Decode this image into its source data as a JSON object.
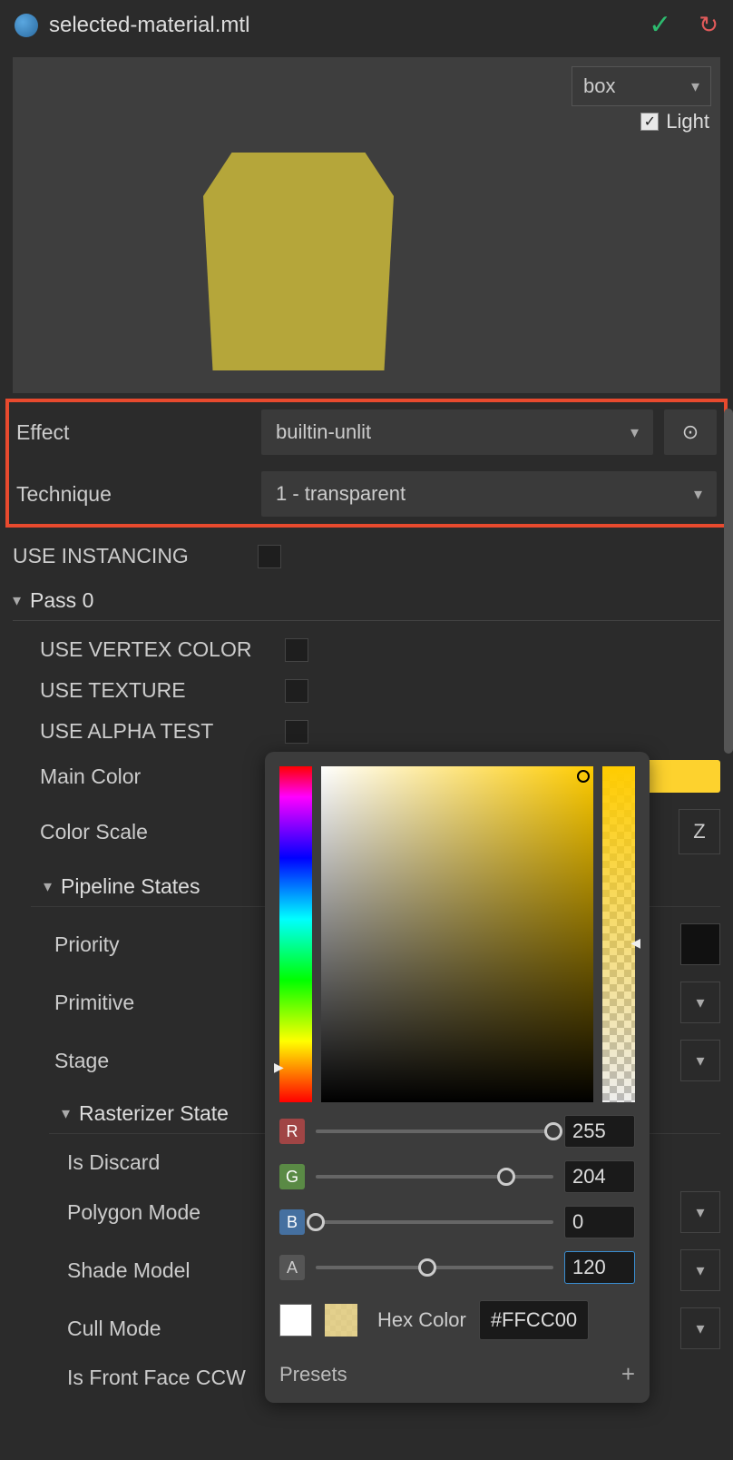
{
  "titlebar": {
    "filename": "selected-material.mtl"
  },
  "preview": {
    "shape_dropdown": "box",
    "light_label": "Light",
    "light_checked": true
  },
  "fields": {
    "effect": {
      "label": "Effect",
      "value": "builtin-unlit"
    },
    "technique": {
      "label": "Technique",
      "value": "1 - transparent"
    },
    "use_instancing": {
      "label": "USE INSTANCING"
    },
    "pass0": {
      "label": "Pass 0"
    },
    "use_vertex_color": {
      "label": "USE VERTEX COLOR"
    },
    "use_texture": {
      "label": "USE TEXTURE"
    },
    "use_alpha_test": {
      "label": "USE ALPHA TEST"
    },
    "main_color": {
      "label": "Main Color"
    },
    "color_scale": {
      "label": "Color Scale",
      "z": "Z"
    },
    "pipeline_states": {
      "label": "Pipeline States"
    },
    "priority": {
      "label": "Priority"
    },
    "primitive": {
      "label": "Primitive"
    },
    "stage": {
      "label": "Stage"
    },
    "rasterizer_state": {
      "label": "Rasterizer State"
    },
    "is_discard": {
      "label": "Is Discard"
    },
    "polygon_mode": {
      "label": "Polygon Mode"
    },
    "shade_model": {
      "label": "Shade Model"
    },
    "cull_mode": {
      "label": "Cull Mode"
    },
    "is_front_face_ccw": {
      "label": "Is Front Face CCW"
    }
  },
  "color_picker": {
    "r": {
      "label": "R",
      "value": "255",
      "pct": 100
    },
    "g": {
      "label": "G",
      "value": "204",
      "pct": 80
    },
    "b": {
      "label": "B",
      "value": "0",
      "pct": 0
    },
    "a": {
      "label": "A",
      "value": "120",
      "pct": 47
    },
    "hex_label": "Hex Color",
    "hex_value": "#FFCC00",
    "presets_label": "Presets"
  }
}
